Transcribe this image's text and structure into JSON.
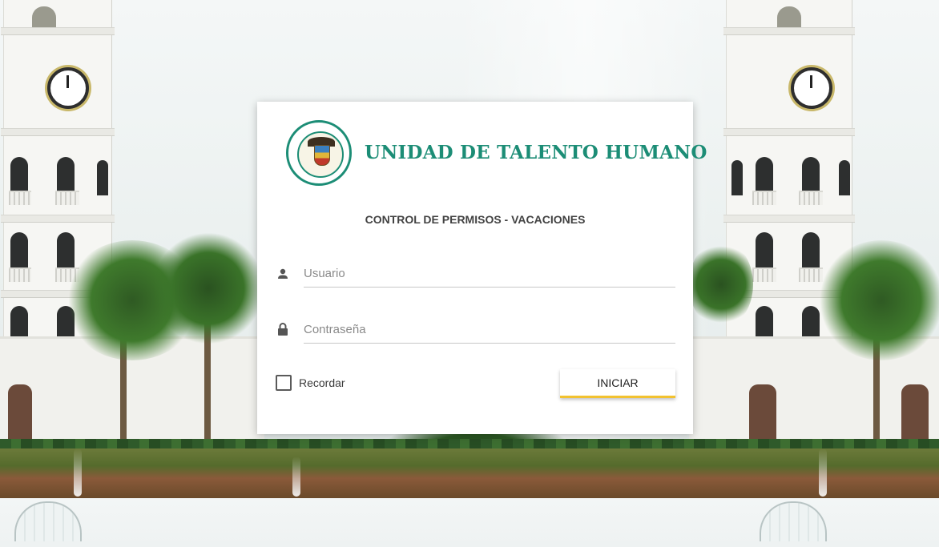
{
  "header": {
    "title": "UNIDAD DE TALENTO HUMANO",
    "subtitle": "CONTROL DE PERMISOS - VACACIONES"
  },
  "login": {
    "username": {
      "value": "",
      "placeholder": "Usuario",
      "icon": "person-icon"
    },
    "password": {
      "value": "",
      "placeholder": "Contraseña",
      "icon": "lock-icon"
    },
    "remember": {
      "label": "Recordar",
      "checked": false
    },
    "submit_label": "INICIAR"
  },
  "colors": {
    "brand": "#1c8d76",
    "button_accent": "#f2c230"
  }
}
